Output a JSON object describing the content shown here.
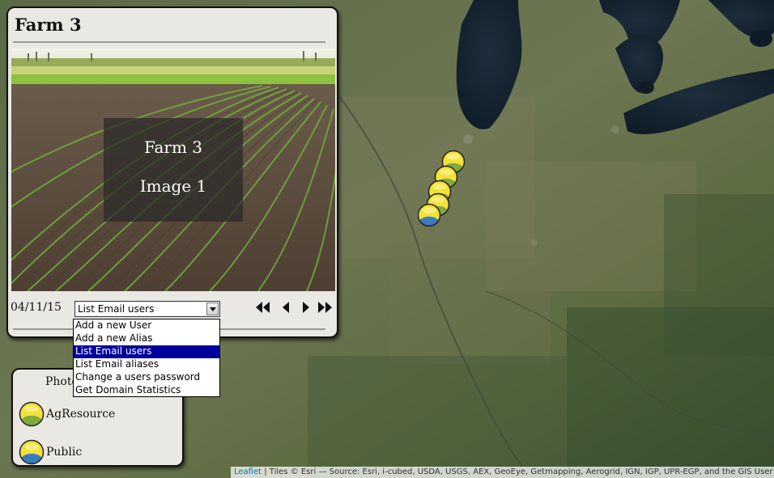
{
  "panel": {
    "title": "Farm 3",
    "photo_caption_line1": "Farm 3",
    "photo_caption_line2": "Image 1",
    "date": "04/11/15",
    "select": {
      "value": "List Email users",
      "options": [
        "Add a new User",
        "Add a new Alias",
        "List Email users",
        "List Email aliases",
        "Change a users password",
        "Get Domain Statistics"
      ],
      "selected_index": 2
    },
    "nav_icons": [
      "first-icon",
      "previous-icon",
      "next-icon",
      "last-icon"
    ]
  },
  "legend": {
    "title": "Photo",
    "items": [
      {
        "label": "AgResource",
        "icon": "agresource-marker-icon",
        "colors": {
          "top": "#f3e13a",
          "bottom": "#7faa3c"
        }
      },
      {
        "label": "Public",
        "icon": "public-marker-icon",
        "colors": {
          "top": "#f3e13a",
          "bottom": "#3a7bbf"
        }
      }
    ]
  },
  "map": {
    "markers": [
      {
        "type": "AgResource"
      },
      {
        "type": "AgResource"
      },
      {
        "type": "AgResource"
      },
      {
        "type": "AgResource"
      },
      {
        "type": "Public"
      }
    ]
  },
  "attribution": {
    "link": "Leaflet",
    "text": " | Tiles © Esri — Source: Esri, i-cubed, USDA, USGS, AEX, GeoEye, Getmapping, Aerogrid, IGN, IGP, UPR-EGP, and the GIS User Com"
  }
}
